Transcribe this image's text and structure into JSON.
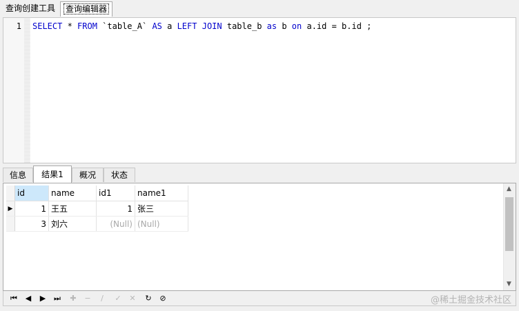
{
  "top_tabs": [
    {
      "label": "查询创建工具"
    },
    {
      "label": "查询编辑器"
    }
  ],
  "editor": {
    "line_number": "1",
    "tokens": [
      {
        "text": "SELECT",
        "kw": true
      },
      {
        "text": " * ",
        "kw": false
      },
      {
        "text": "FROM",
        "kw": true
      },
      {
        "text": " `table_A` ",
        "kw": false
      },
      {
        "text": "AS",
        "kw": true
      },
      {
        "text": " a ",
        "kw": false
      },
      {
        "text": "LEFT",
        "kw": true
      },
      {
        "text": " ",
        "kw": false
      },
      {
        "text": "JOIN",
        "kw": true
      },
      {
        "text": " table_b ",
        "kw": false
      },
      {
        "text": "as",
        "kw": true
      },
      {
        "text": " b ",
        "kw": false
      },
      {
        "text": "on",
        "kw": true
      },
      {
        "text": " a.id = b.id ;",
        "kw": false
      }
    ],
    "keyword_color": "#0000cc"
  },
  "result_tabs": [
    {
      "label": "信息"
    },
    {
      "label": "结果1"
    },
    {
      "label": "概况"
    },
    {
      "label": "状态"
    }
  ],
  "grid": {
    "columns": [
      "id",
      "name",
      "id1",
      "name1"
    ],
    "rows": [
      {
        "id": "1",
        "name": "王五",
        "id1": "1",
        "name1": "张三",
        "current": true
      },
      {
        "id": "3",
        "name": "刘六",
        "id1": "(Null)",
        "name1": "(Null)",
        "current": false
      }
    ],
    "selected_header_color": "#cde8fb"
  },
  "toolbar": {
    "buttons": [
      {
        "name": "first-record-icon",
        "glyph": "⏮",
        "enabled": true
      },
      {
        "name": "previous-record-icon",
        "glyph": "◀",
        "enabled": true
      },
      {
        "name": "next-record-icon",
        "glyph": "▶",
        "enabled": true
      },
      {
        "name": "last-record-icon",
        "glyph": "⏭",
        "enabled": true
      },
      {
        "name": "add-record-icon",
        "glyph": "✚",
        "enabled": false
      },
      {
        "name": "delete-record-icon",
        "glyph": "−",
        "enabled": false
      },
      {
        "name": "edit-record-icon",
        "glyph": "∕",
        "enabled": false
      },
      {
        "name": "apply-changes-icon",
        "glyph": "✓",
        "enabled": false
      },
      {
        "name": "discard-changes-icon",
        "glyph": "✕",
        "enabled": false
      },
      {
        "name": "refresh-icon",
        "glyph": "↻",
        "enabled": true
      },
      {
        "name": "stop-icon",
        "glyph": "⊘",
        "enabled": true
      }
    ]
  },
  "watermark": "@稀土掘金技术社区"
}
